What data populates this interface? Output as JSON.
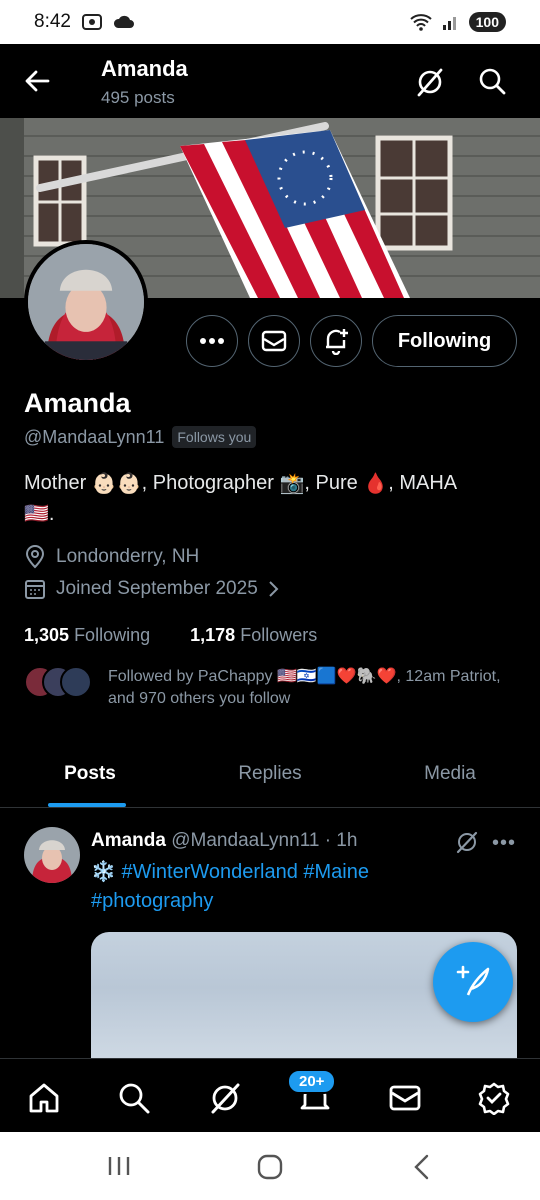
{
  "status_bar": {
    "time": "8:42",
    "battery": "100"
  },
  "header": {
    "title": "Amanda",
    "subtitle": "495 posts"
  },
  "profile": {
    "name": "Amanda",
    "handle": "@MandaaLynn11",
    "follows_you": "Follows you",
    "following_button": "Following",
    "bio_parts": [
      "Mother ",
      ", Photographer ",
      ", Pure ",
      ", MAHA"
    ],
    "bio_end": ".",
    "location": "Londonderry, NH",
    "joined": "Joined September 2025",
    "following_count": "1,305",
    "following_label": "Following",
    "followers_count": "1,178",
    "followers_label": "Followers",
    "followed_by": "Followed by PaChappy 🇺🇸🇮🇱🟦❤️🐘❤️, 12am Patriot, and 970 others you follow"
  },
  "tabs": [
    {
      "label": "Posts",
      "active": true
    },
    {
      "label": "Replies",
      "active": false
    },
    {
      "label": "Media",
      "active": false
    }
  ],
  "post": {
    "author": "Amanda",
    "handle": "@MandaaLynn11",
    "time": "· 1h",
    "more": "•••",
    "text_line1": "❄️ #WinterWonderland #Maine",
    "text_line2": "#photography"
  },
  "bottom_nav": {
    "notification_badge": "20+"
  },
  "colors": {
    "accent": "#1d9bf0",
    "background": "#000000",
    "muted": "#8b98a5"
  }
}
